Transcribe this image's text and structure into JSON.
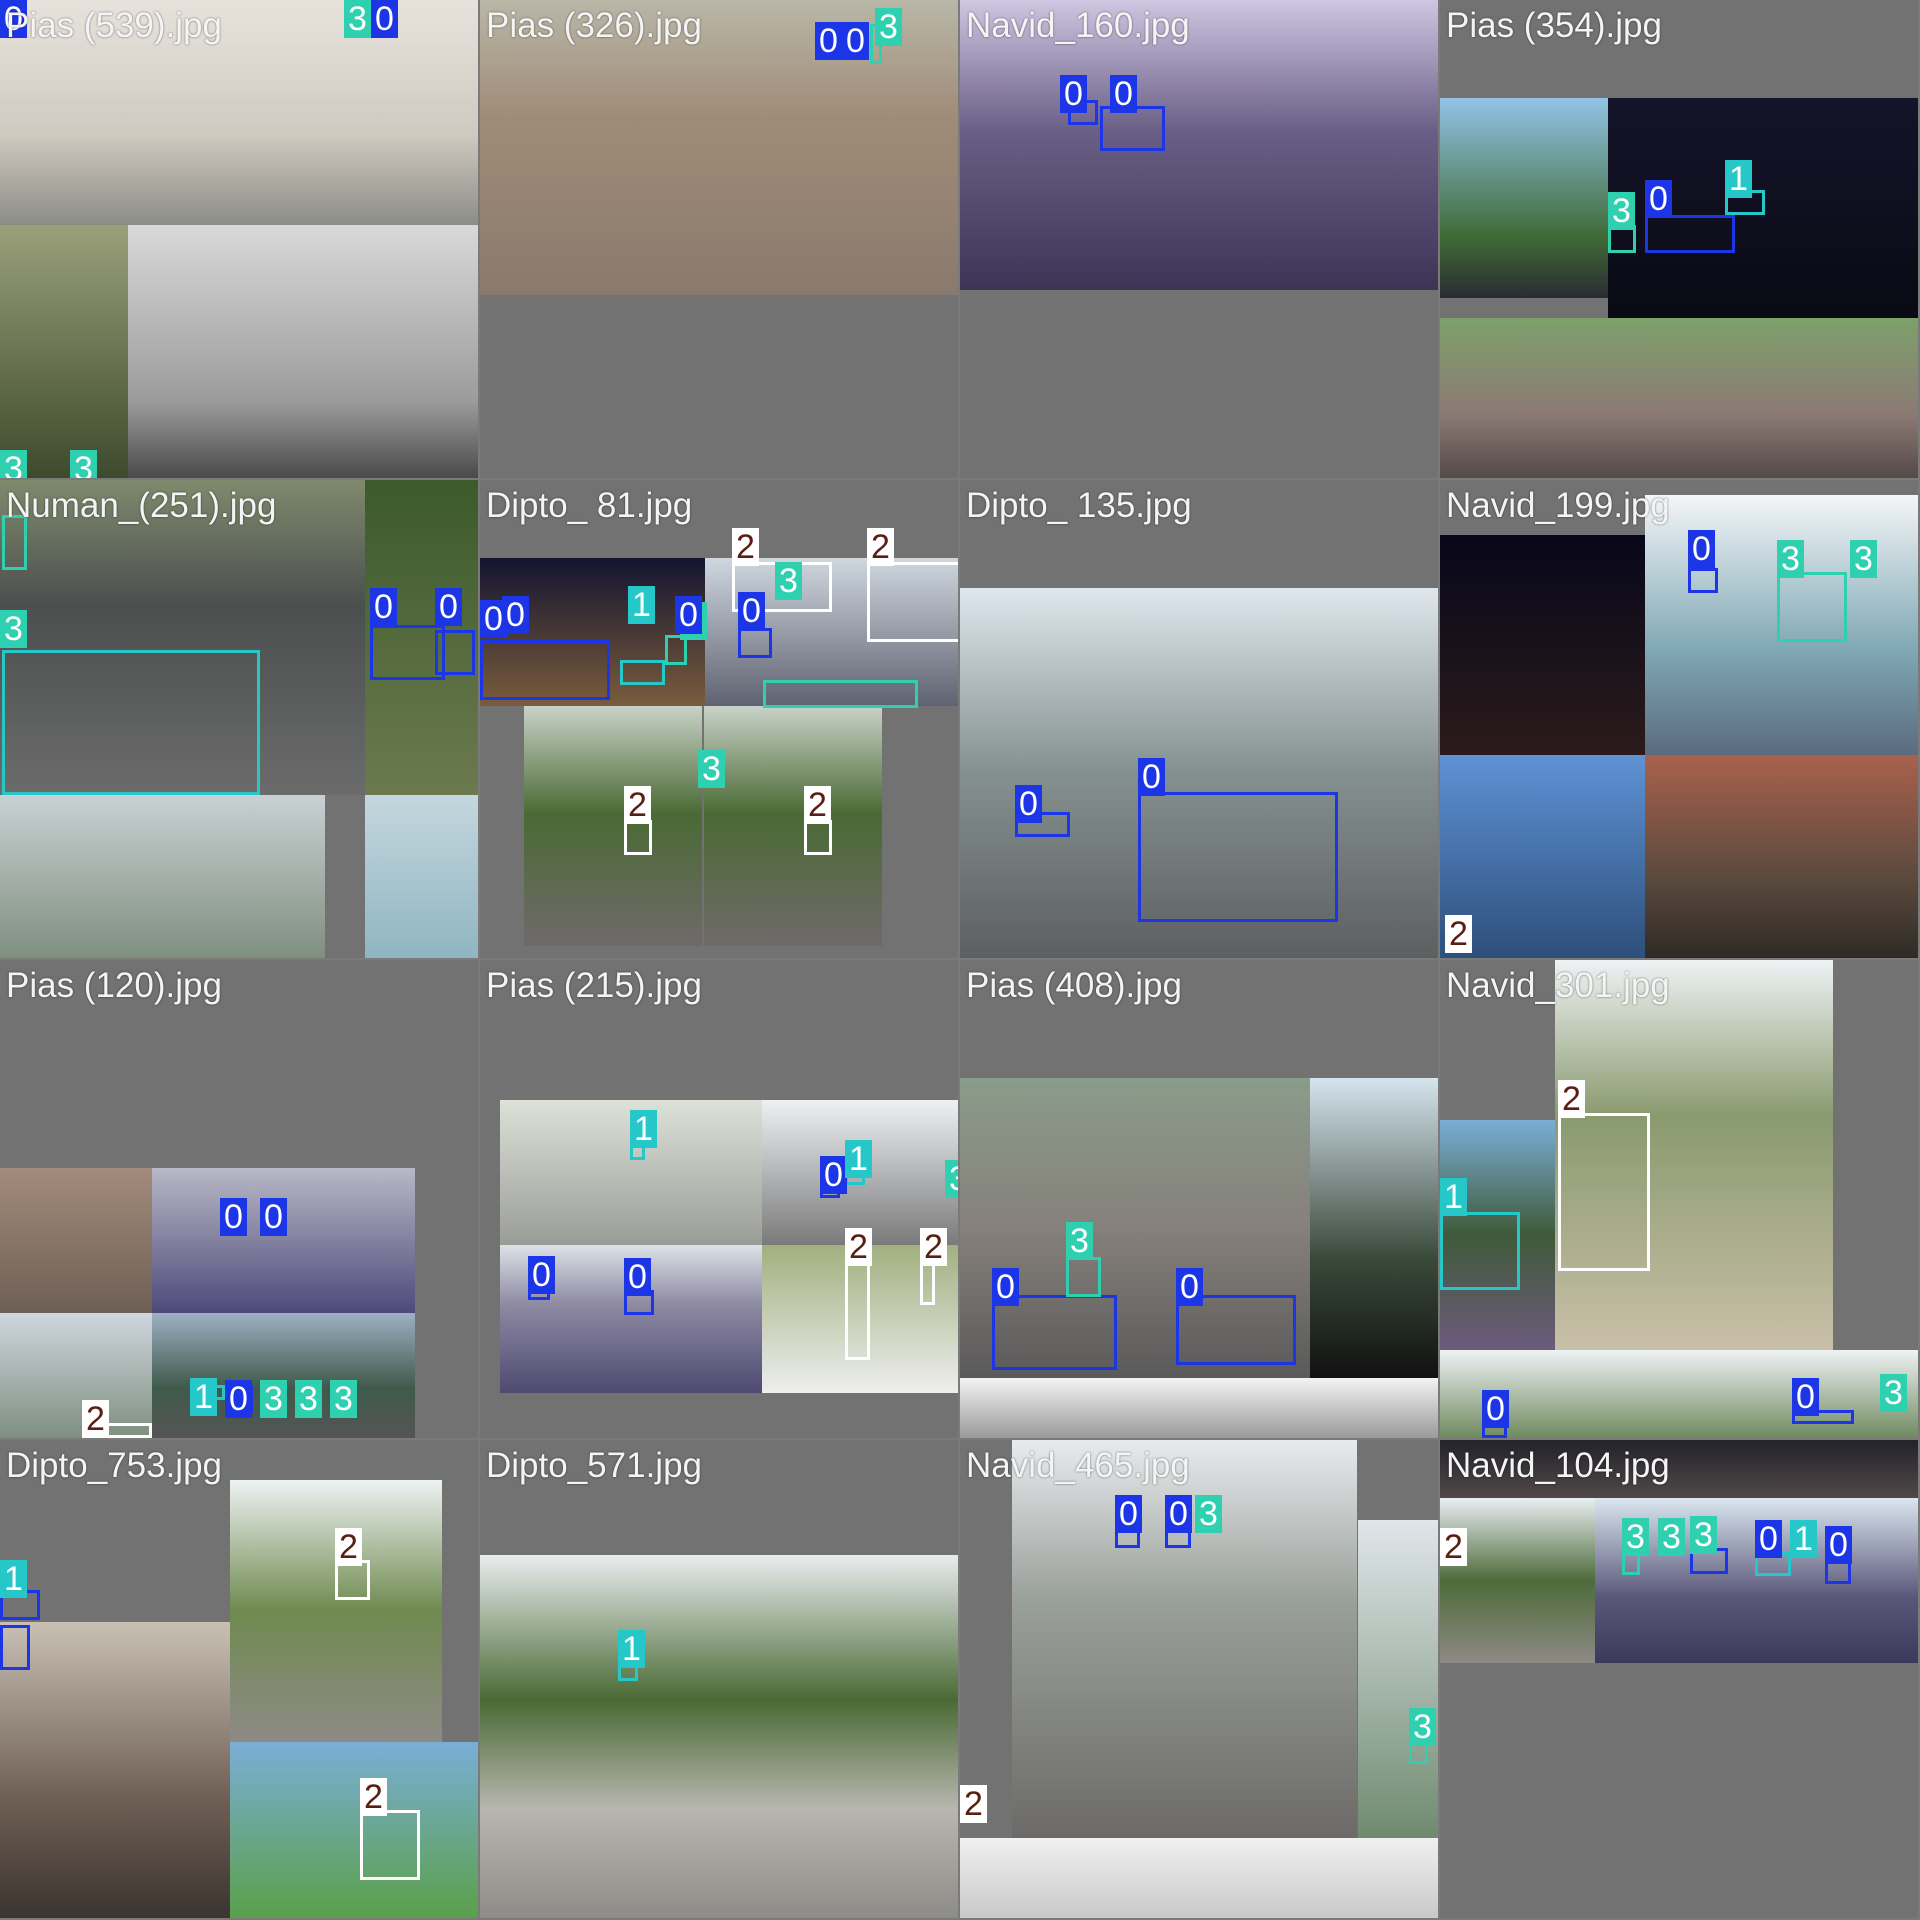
{
  "grid_tiles": [
    {
      "title": "Pias (539).jpg"
    },
    {
      "title": "Pias (326).jpg"
    },
    {
      "title": "Navid_160.jpg"
    },
    {
      "title": "Pias (354).jpg"
    },
    {
      "title": "Numan_(251).jpg"
    },
    {
      "title": "Dipto_ 81.jpg"
    },
    {
      "title": "Dipto_ 135.jpg"
    },
    {
      "title": "Navid_199.jpg"
    },
    {
      "title": "Pias (120).jpg"
    },
    {
      "title": "Pias (215).jpg"
    },
    {
      "title": "Pias (408).jpg"
    },
    {
      "title": "Navid_301.jpg"
    },
    {
      "title": "Dipto_753.jpg"
    },
    {
      "title": "Dipto_571.jpg"
    },
    {
      "title": "Navid_465.jpg"
    },
    {
      "title": "Navid_104.jpg"
    }
  ],
  "class_colors": {
    "0": "#1c35e6",
    "1": "#25c7c9",
    "2": "#ffffff",
    "3": "#2ed0b0"
  },
  "photo_labels": {
    "scene": "road-scene-photo"
  }
}
